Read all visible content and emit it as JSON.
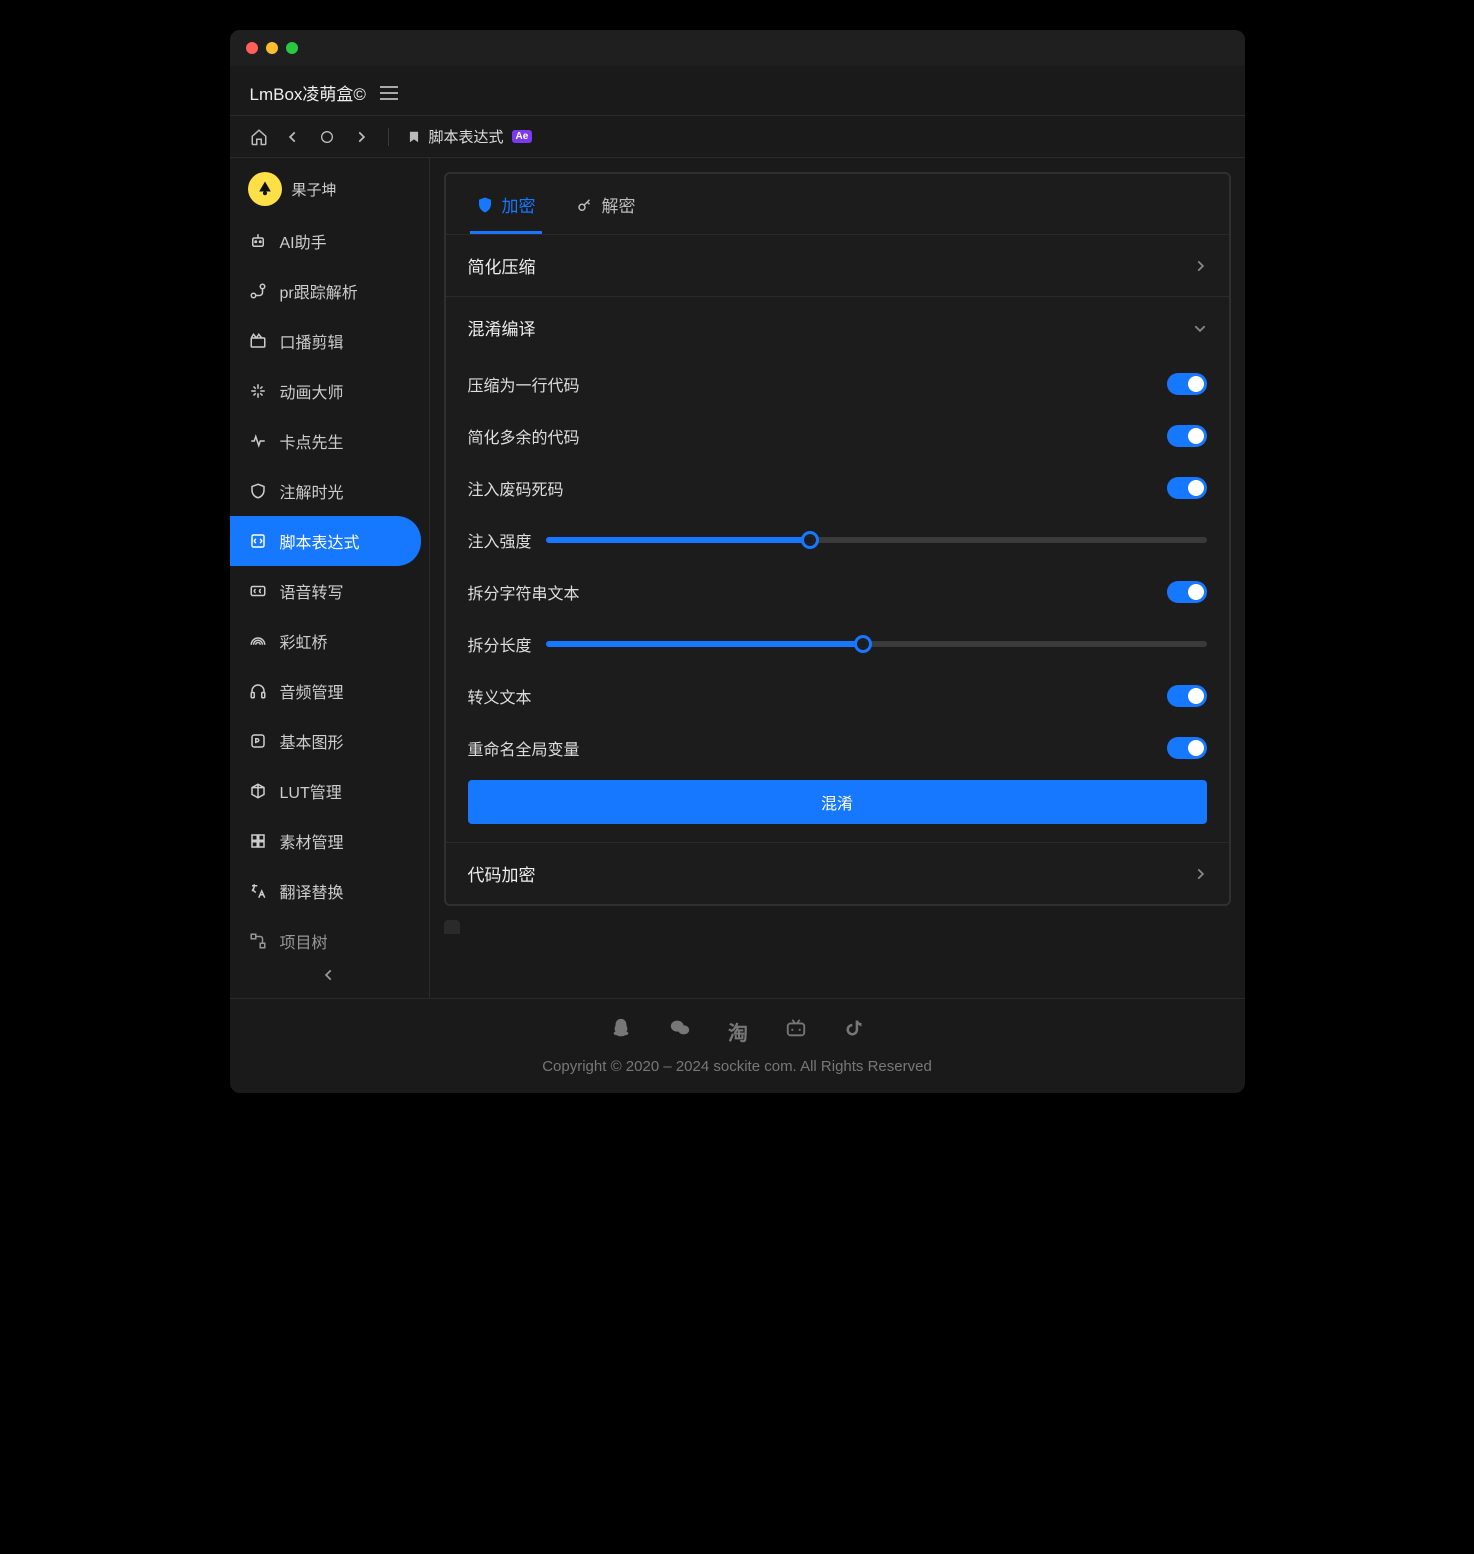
{
  "app_title": "LmBox凌萌盒©",
  "breadcrumb": {
    "label": "脚本表达式",
    "badge": "Ae"
  },
  "user": {
    "name": "果子坤"
  },
  "sidebar": {
    "items": [
      {
        "label": "AI助手",
        "active": false
      },
      {
        "label": "pr跟踪解析",
        "active": false
      },
      {
        "label": "口播剪辑",
        "active": false
      },
      {
        "label": "动画大师",
        "active": false
      },
      {
        "label": "卡点先生",
        "active": false
      },
      {
        "label": "注解时光",
        "active": false
      },
      {
        "label": "脚本表达式",
        "active": true
      },
      {
        "label": "语音转写",
        "active": false
      },
      {
        "label": "彩虹桥",
        "active": false
      },
      {
        "label": "音频管理",
        "active": false
      },
      {
        "label": "基本图形",
        "active": false
      },
      {
        "label": "LUT管理",
        "active": false
      },
      {
        "label": "素材管理",
        "active": false
      },
      {
        "label": "翻译替换",
        "active": false
      },
      {
        "label": "项目树",
        "active": false
      }
    ]
  },
  "tabs": {
    "encrypt": "加密",
    "decrypt": "解密"
  },
  "sections": {
    "simplify": {
      "title": "简化压缩",
      "open": false
    },
    "obfuscate": {
      "title": "混淆编译",
      "open": true
    },
    "encrypt": {
      "title": "代码加密",
      "open": false
    }
  },
  "obfuscate": {
    "compress_one_line": {
      "label": "压缩为一行代码",
      "on": true
    },
    "simplify_redundant": {
      "label": "简化多余的代码",
      "on": true
    },
    "inject_dead_code": {
      "label": "注入废码死码",
      "on": true
    },
    "inject_strength": {
      "label": "注入强度",
      "value": 40
    },
    "split_strings": {
      "label": "拆分字符串文本",
      "on": true
    },
    "split_length": {
      "label": "拆分长度",
      "value": 48
    },
    "escape_text": {
      "label": "转义文本",
      "on": true
    },
    "rename_globals": {
      "label": "重命名全局变量",
      "on": true
    },
    "action_label": "混淆"
  },
  "footer": {
    "copyright": "Copyright © 2020 – 2024 sockite com. All Rights Reserved"
  }
}
